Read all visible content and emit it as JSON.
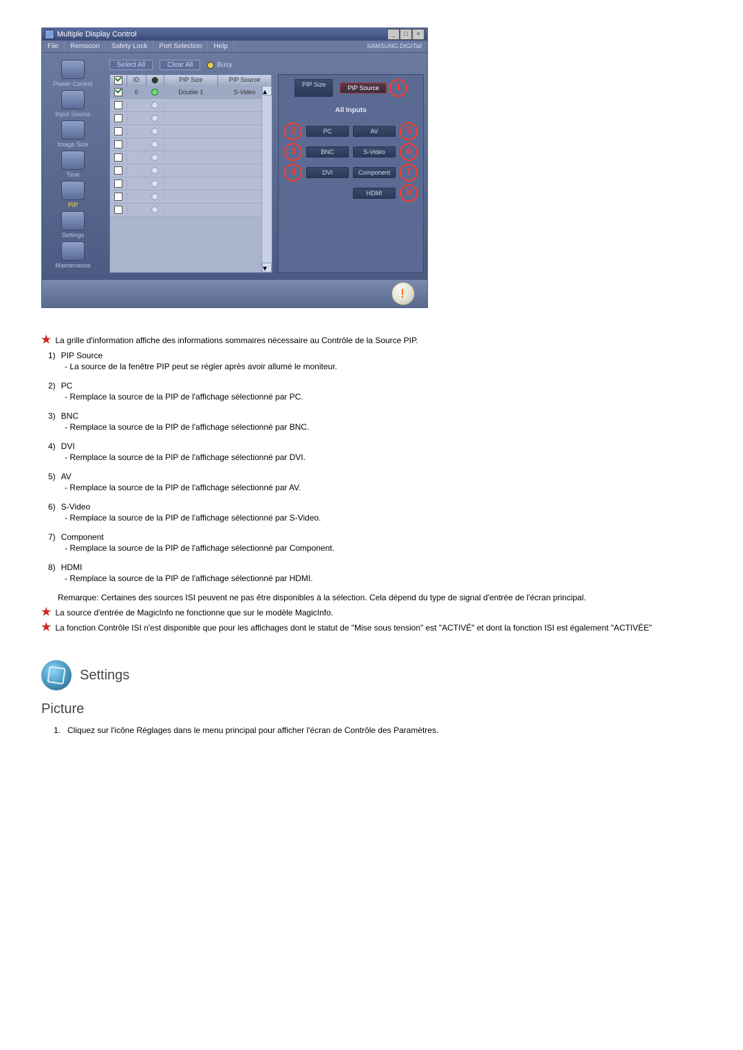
{
  "window": {
    "title": "Multiple Display Control",
    "menu": [
      "File",
      "Remocon",
      "Safety Lock",
      "Port Selection",
      "Help"
    ],
    "brand": "SAMSUNG DIGITall"
  },
  "sidebar": [
    {
      "label": "Power Control"
    },
    {
      "label": "Input Source"
    },
    {
      "label": "Image Size"
    },
    {
      "label": "Time"
    },
    {
      "label": "PIP",
      "active": true
    },
    {
      "label": "Settings"
    },
    {
      "label": "Maintenance"
    }
  ],
  "toolbar": {
    "select_all": "Select All",
    "clear_all": "Clear All",
    "busy": "Busy"
  },
  "table": {
    "headers": {
      "id": "ID",
      "size": "PIP Size",
      "source": "PIP Source"
    },
    "row": {
      "id": "0",
      "size": "Double 1",
      "source": "S-Video"
    }
  },
  "right_panel": {
    "pip_size": "PIP Size",
    "pip_source": "PIP Source",
    "all_inputs": "All Inputs",
    "buttons": {
      "pc": "PC",
      "bnc": "BNC",
      "dvi": "DVI",
      "av": "AV",
      "svideo": "S-Video",
      "component": "Component",
      "hdmi": "HDMI"
    },
    "annotations": {
      "a1": "1",
      "a2": "2",
      "a3": "3",
      "a4": "4",
      "a5": "5",
      "a6": "6",
      "a7": "7",
      "a8": "8"
    }
  },
  "text": {
    "intro": "La grille d'information affiche des informations sommaires nécessaire au Contrôle de la Source PIP.",
    "items": [
      {
        "n": "1)",
        "t": "PIP Source",
        "d": "- La source de la fenêtre PIP peut se régler après avoir allumé le moniteur."
      },
      {
        "n": "2)",
        "t": "PC",
        "d": "- Remplace la source de la PIP de l'affichage sélectionné par PC."
      },
      {
        "n": "3)",
        "t": "BNC",
        "d": "- Remplace la source de la PIP de l'affichage sélectionné par BNC."
      },
      {
        "n": "4)",
        "t": "DVI",
        "d": "- Remplace la source de la PIP de l'affichage sélectionné par DVI."
      },
      {
        "n": "5)",
        "t": "AV",
        "d": "- Remplace la source de la PIP de l'affichage sélectionné par AV."
      },
      {
        "n": "6)",
        "t": "S-Video",
        "d": "- Remplace la source de la PIP de l'affichage sélectionné par S-Video."
      },
      {
        "n": "7)",
        "t": "Component",
        "d": "- Remplace la source de la PIP de l'affichage sélectionné par Component."
      },
      {
        "n": "8)",
        "t": "HDMI",
        "d": "- Remplace la source de la PIP de l'affichage sélectionné par HDMI."
      }
    ],
    "remark": "Remarque: Certaines des sources ISI peuvent ne pas être disponibles à la sélection. Cela dépend du type de signal d'entrée de l'écran principal.",
    "note1": "La source d'entrée de MagicInfo ne fonctionne que sur le modèle MagicInfo.",
    "note2": "La fonction Contrôle ISI n'est disponible que pour les affichages dont le statut de \"Mise sous tension\" est \"ACTIVÉ\" et dont la fonction ISI est également \"ACTIVÉE\""
  },
  "section": {
    "title": "Settings"
  },
  "picture": {
    "title": "Picture",
    "line1_n": "1.",
    "line1": "Cliquez sur l'icône Réglages dans le menu principal pour afficher l'écran de Contrôle des Paramètres."
  }
}
